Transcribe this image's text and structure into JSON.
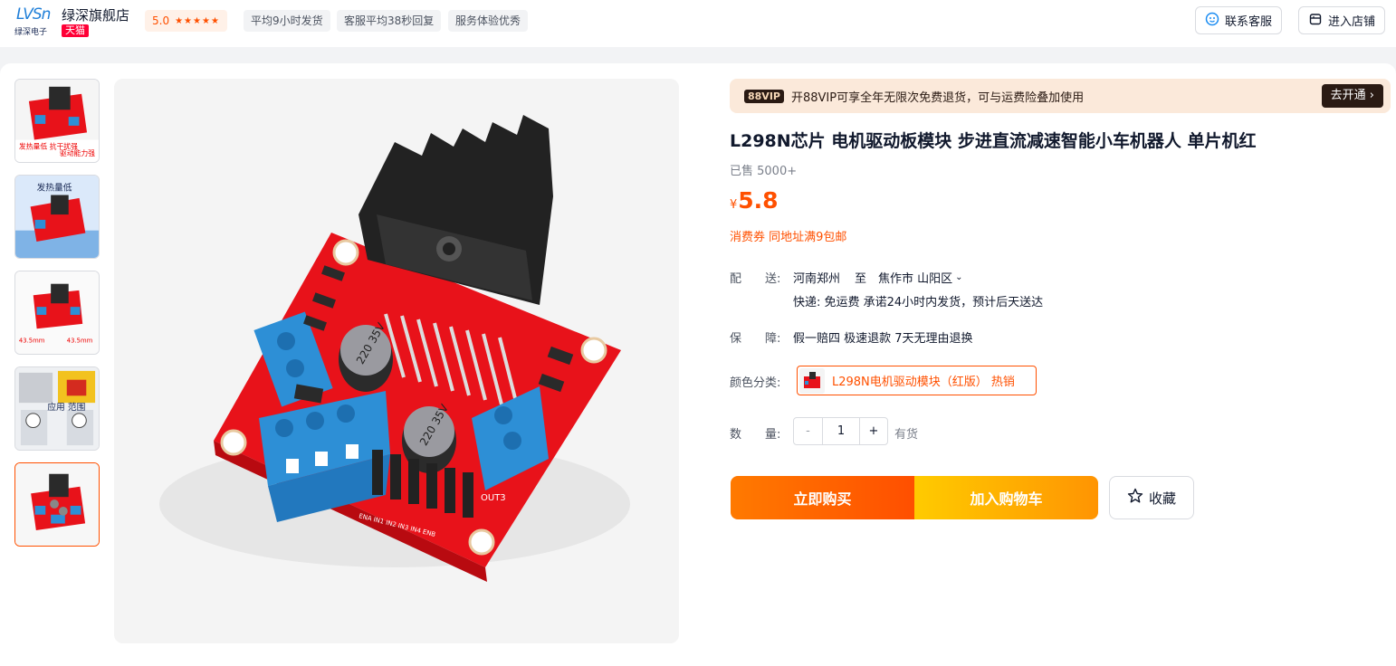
{
  "shop": {
    "logo_text": "LVSn",
    "logo_sub": "绿深电子",
    "name": "绿深旗舰店",
    "badge": "天猫",
    "rating": "5.0",
    "tags": [
      "平均9小时发货",
      "客服平均38秒回复",
      "服务体验优秀"
    ],
    "contact_label": "联系客服",
    "enter_label": "进入店铺"
  },
  "gallery": {
    "thumbnails": [
      {
        "caption_left": "发热量低 抗干扰强",
        "caption_right": "驱动能力强"
      },
      {
        "caption": "发热量低"
      },
      {
        "caption_left": "43.5mm",
        "caption_right": "43.5mm"
      },
      {
        "caption": "应用 范围"
      },
      {
        "caption": ""
      }
    ],
    "main_labels": {
      "out3": "OUT3",
      "cap1": "220 35V",
      "cap2": "220 35V",
      "pins": "ENA IN1 IN2 IN3 IN4 ENB"
    }
  },
  "vip": {
    "badge": "88VIP",
    "text": "开88VIP可享全年无限次免费退货，可与运费险叠加使用",
    "button": "去开通 ›"
  },
  "product": {
    "title": "L298N芯片 电机驱动板模块 步进直流减速智能小车机器人 单片机红",
    "sold": "已售 5000+",
    "currency": "¥",
    "price": "5.8",
    "coupon": "消费券 同地址满9包邮"
  },
  "delivery": {
    "label": "配　　送:",
    "from": "河南郑州",
    "to_word": "至",
    "to": "焦作市 山阳区",
    "line2": "快递: 免运费  承诺24小时内发货，预计后天送达"
  },
  "guarantee": {
    "label": "保　　障:",
    "value": "假一赔四 极速退款 7天无理由退换"
  },
  "color": {
    "label": "颜色分类:",
    "option": "L298N电机驱动模块（红版） 热销"
  },
  "quantity": {
    "label": "数　　量:",
    "minus": "-",
    "value": "1",
    "plus": "+",
    "stock": "有货"
  },
  "actions": {
    "buy_now": "立即购买",
    "add_cart": "加入购物车",
    "favorite": "收藏"
  },
  "colors": {
    "accent": "#ff5000",
    "board": "#e8121a",
    "terminal": "#2d8fd6"
  }
}
